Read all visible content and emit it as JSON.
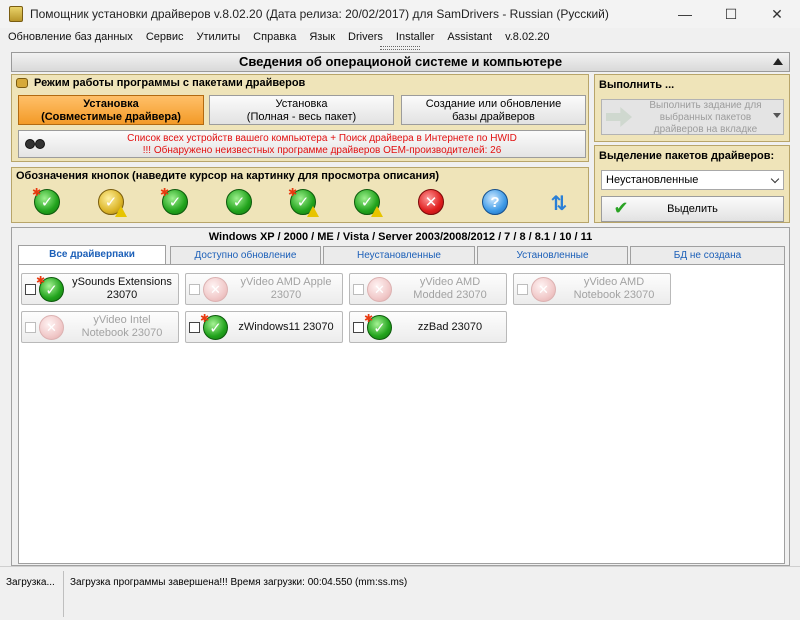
{
  "window": {
    "title": "Помощник установки драйверов v.8.02.20 (Дата релиза: 20/02/2017) для SamDrivers - Russian (Русский)"
  },
  "menu": [
    "Обновление баз данных",
    "Сервис",
    "Утилиты",
    "Справка",
    "Язык",
    "Drivers",
    "Installer",
    "Assistant",
    "v.8.02.20"
  ],
  "section_title": "Сведения об операционой системе и компьютере",
  "mode_panel": {
    "title": "Режим работы программы с пакетами драйверов",
    "buttons": [
      {
        "line1": "Установка",
        "line2": "(Совместимые драйвера)",
        "active": true
      },
      {
        "line1": "Установка",
        "line2": "(Полная - весь пакет)",
        "active": false
      },
      {
        "line1": "Создание или обновление",
        "line2": "базы драйверов",
        "active": false
      }
    ],
    "info_line1": "Список всех устройств вашего компьютера + Поиск драйвера в Интернете по HWID",
    "info_line2": "!!! Обнаружено неизвестных программе драйверов OEM-производителей: 26"
  },
  "legend_panel": {
    "title": "Обозначения кнопок (наведите курсор на картинку для просмотра описания)",
    "icons": [
      "green-check-new-icon",
      "yellow-check-warning-icon",
      "green-check-star-icon",
      "green-check-icon",
      "green-check-star-warning-icon",
      "green-check-warning-icon",
      "red-cross-icon",
      "blue-question-icon",
      "refresh-arrows-icon"
    ]
  },
  "execute_panel": {
    "title": "Выполнить ...",
    "button_line1": "Выполнить задание для",
    "button_line2": "выбранных пакетов",
    "button_line3": "драйверов на вкладке"
  },
  "select_panel": {
    "title": "Выделение пакетов драйверов:",
    "selected": "Неустановленные",
    "button": "Выделить"
  },
  "drivers": {
    "os_line": "Windows XP / 2000 / ME / Vista / Server 2003/2008/2012 / 7 / 8 / 8.1 / 10 / 11",
    "tabs": [
      "Все драйверпаки",
      "Доступно обновление",
      "Неустановленные",
      "Установленные",
      "БД не создана"
    ],
    "active_tab": 0,
    "cards": [
      {
        "line1": "ySounds Extensions",
        "line2": "23070",
        "status": "ok"
      },
      {
        "line1": "yVideo AMD Apple",
        "line2": "23070",
        "status": "disabled"
      },
      {
        "line1": "yVideo AMD",
        "line2": "Modded 23070",
        "status": "disabled"
      },
      {
        "line1": "yVideo AMD",
        "line2": "Notebook 23070",
        "status": "disabled"
      },
      {
        "line1": "yVideo Intel",
        "line2": "Notebook 23070",
        "status": "disabled"
      },
      {
        "line1": "zWindows11 23070",
        "line2": "",
        "status": "ok"
      },
      {
        "line1": "zzBad 23070",
        "line2": "",
        "status": "ok"
      }
    ]
  },
  "status": {
    "left": "Загрузка...",
    "message": "Загрузка программы завершена!!! Время загрузки: 00:04.550 (mm:ss.ms)"
  }
}
